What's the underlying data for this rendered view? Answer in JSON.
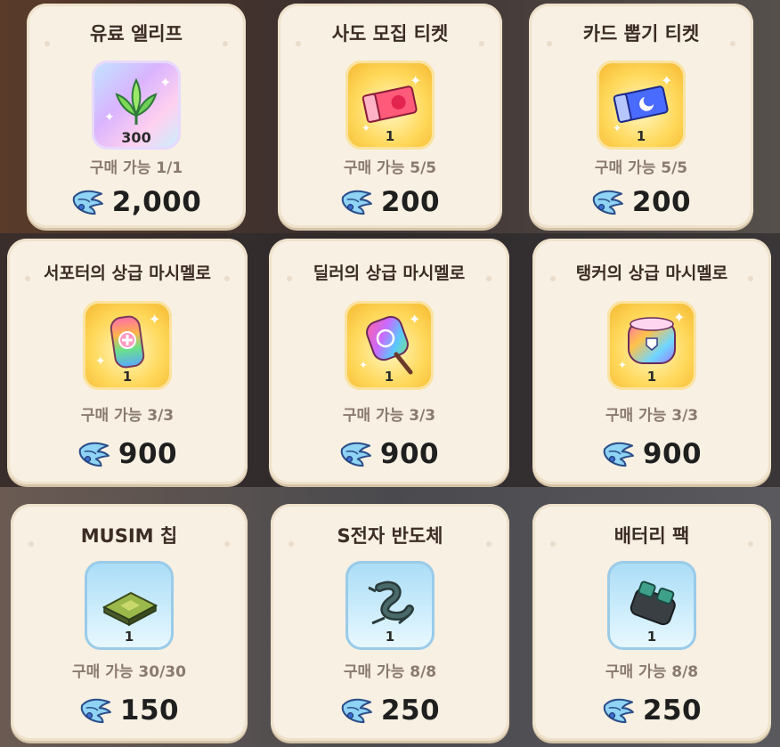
{
  "currency_icon": "blue-wing-crystal-icon",
  "colors": {
    "card_bg": "#f8f0e2",
    "title": "#3b2c24",
    "limit": "#8a7a70",
    "price": "#1f1f1f"
  },
  "items": [
    {
      "name": "유료 엘리프",
      "icon": "elif-sprout-icon",
      "qty": "300",
      "limit": "구매 가능 1/1",
      "price": "2,000"
    },
    {
      "name": "사도 모집 티켓",
      "icon": "red-ticket-icon",
      "qty": "1",
      "limit": "구매 가능 5/5",
      "price": "200"
    },
    {
      "name": "카드 뽑기 티켓",
      "icon": "blue-ticket-icon",
      "qty": "1",
      "limit": "구매 가능 5/5",
      "price": "200"
    },
    {
      "name": "서포터의 상급 마시멜로",
      "icon": "supporter-marshmallow-icon",
      "qty": "1",
      "limit": "구매 가능 3/3",
      "price": "900"
    },
    {
      "name": "딜러의 상급 마시멜로",
      "icon": "dealer-marshmallow-icon",
      "qty": "1",
      "limit": "구매 가능 3/3",
      "price": "900"
    },
    {
      "name": "탱커의 상급 마시멜로",
      "icon": "tanker-marshmallow-icon",
      "qty": "1",
      "limit": "구매 가능 3/3",
      "price": "900"
    },
    {
      "name": "MUSIM 칩",
      "icon": "chip-icon",
      "qty": "1",
      "limit": "구매 가능 30/30",
      "price": "150"
    },
    {
      "name": "S전자 반도체",
      "icon": "semiconductor-icon",
      "qty": "1",
      "limit": "구매 가능 8/8",
      "price": "250"
    },
    {
      "name": "배터리 팩",
      "icon": "battery-pack-icon",
      "qty": "1",
      "limit": "구매 가능 8/8",
      "price": "250"
    }
  ]
}
